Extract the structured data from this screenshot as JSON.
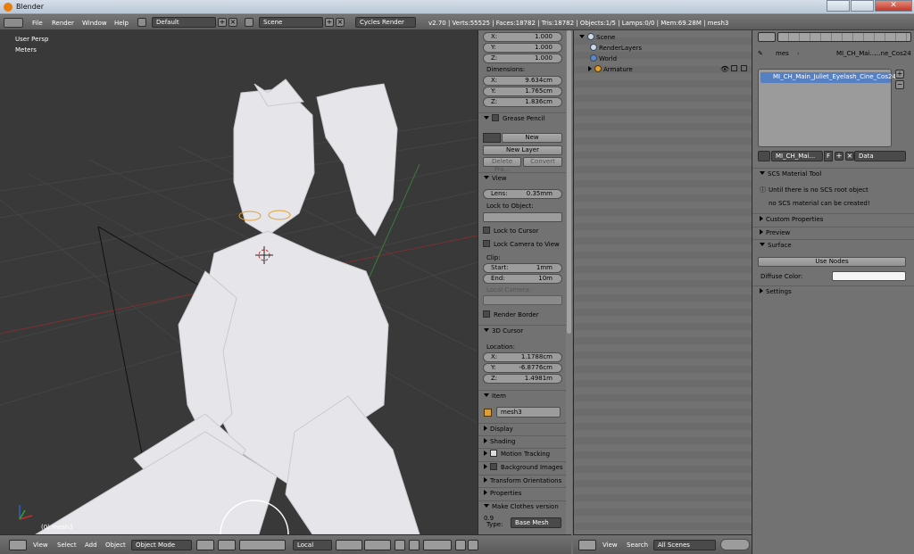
{
  "window": {
    "title": "Blender"
  },
  "topbar": {
    "menus": [
      "File",
      "Render",
      "Window",
      "Help"
    ],
    "screen_layout": "Default",
    "scene": "Scene",
    "engine": "Cycles Render",
    "stats": "v2.70 | Verts:55525 | Faces:18782 | Tris:18782 | Objects:1/5 | Lamps:0/0 | Mem:69.28M | mesh3"
  },
  "viewport": {
    "view_label": "User Persp",
    "units_label": "Meters",
    "object_label": "(0) mesh3",
    "colors": {
      "background": "#393939",
      "grid": "#4a4a4a",
      "x_axis": "#8a3030",
      "y_axis": "#3a7a3a",
      "model": "#e8e8ec"
    }
  },
  "npanel": {
    "scale": [
      {
        "axis": "X:",
        "value": "1.000"
      },
      {
        "axis": "Y:",
        "value": "1.000"
      },
      {
        "axis": "Z:",
        "value": "1.000"
      }
    ],
    "dimensions_label": "Dimensions:",
    "dimensions": [
      {
        "axis": "X:",
        "value": "9.634cm"
      },
      {
        "axis": "Y:",
        "value": "1.765cm"
      },
      {
        "axis": "Z:",
        "value": "1.836cm"
      }
    ],
    "grease_pencil": {
      "title": "Grease Pencil",
      "new": "New",
      "new_layer": "New Layer",
      "delete_frame": "Delete Fra...",
      "convert": "Convert"
    },
    "view": {
      "title": "View",
      "lens_label": "Lens:",
      "lens_value": "0.35mm",
      "lock_to_object": "Lock to Object:",
      "lock_to_cursor": "Lock to Cursor",
      "lock_camera": "Lock Camera to View",
      "clip_label": "Clip:",
      "clip_start_label": "Start:",
      "clip_start_value": "1mm",
      "clip_end_label": "End:",
      "clip_end_value": "10m",
      "local_camera": "Local Camera:",
      "render_border": "Render Border"
    },
    "cursor": {
      "title": "3D Cursor",
      "location_label": "Location:",
      "location": [
        {
          "axis": "X:",
          "value": "1.1788cm"
        },
        {
          "axis": "Y:",
          "value": "-6.8776cm"
        },
        {
          "axis": "Z:",
          "value": "1.4981m"
        }
      ]
    },
    "item": {
      "title": "Item",
      "name": "mesh3"
    },
    "collapsed": [
      "Display",
      "Shading"
    ],
    "motion_tracking": "Motion Tracking",
    "background_images": "Background Images",
    "transform_orientations": "Transform Orientations",
    "properties": "Properties",
    "make_clothes": "Make Clothes version 0.9",
    "type_label": "Type:",
    "type_value": "Base Mesh"
  },
  "outliner": {
    "items": [
      {
        "label": "Scene",
        "icon": "scene-icon"
      },
      {
        "label": "RenderLayers",
        "icon": "renderlayers-icon"
      },
      {
        "label": "World",
        "icon": "world-icon"
      },
      {
        "label": "Armature",
        "icon": "armature-icon"
      }
    ],
    "header": {
      "view": "View",
      "search": "Search",
      "filter": "All Scenes"
    }
  },
  "properties": {
    "breadcrumb_mesh": "mes",
    "breadcrumb_material": "MI_CH_Mai...",
    "breadcrumb_tail": "...ne_Cos24",
    "material_slot": "MI_CH_Main_Juliet_Eyelash_Cine_Cos24",
    "material_name": "MI_CH_Mai...",
    "f_label": "F",
    "link_label": "Data",
    "scs": {
      "title": "SCS Material Tool",
      "line1": "Until there is no SCS root object",
      "line2": "no SCS material can be created!"
    },
    "custom_properties": "Custom Properties",
    "preview": "Preview",
    "surface": "Surface",
    "use_nodes": "Use Nodes",
    "diffuse_label": "Diffuse Color:",
    "settings": "Settings"
  },
  "vp_header": {
    "view": "View",
    "select": "Select",
    "add": "Add",
    "object": "Object",
    "mode": "Object Mode",
    "orientation": "Local"
  }
}
